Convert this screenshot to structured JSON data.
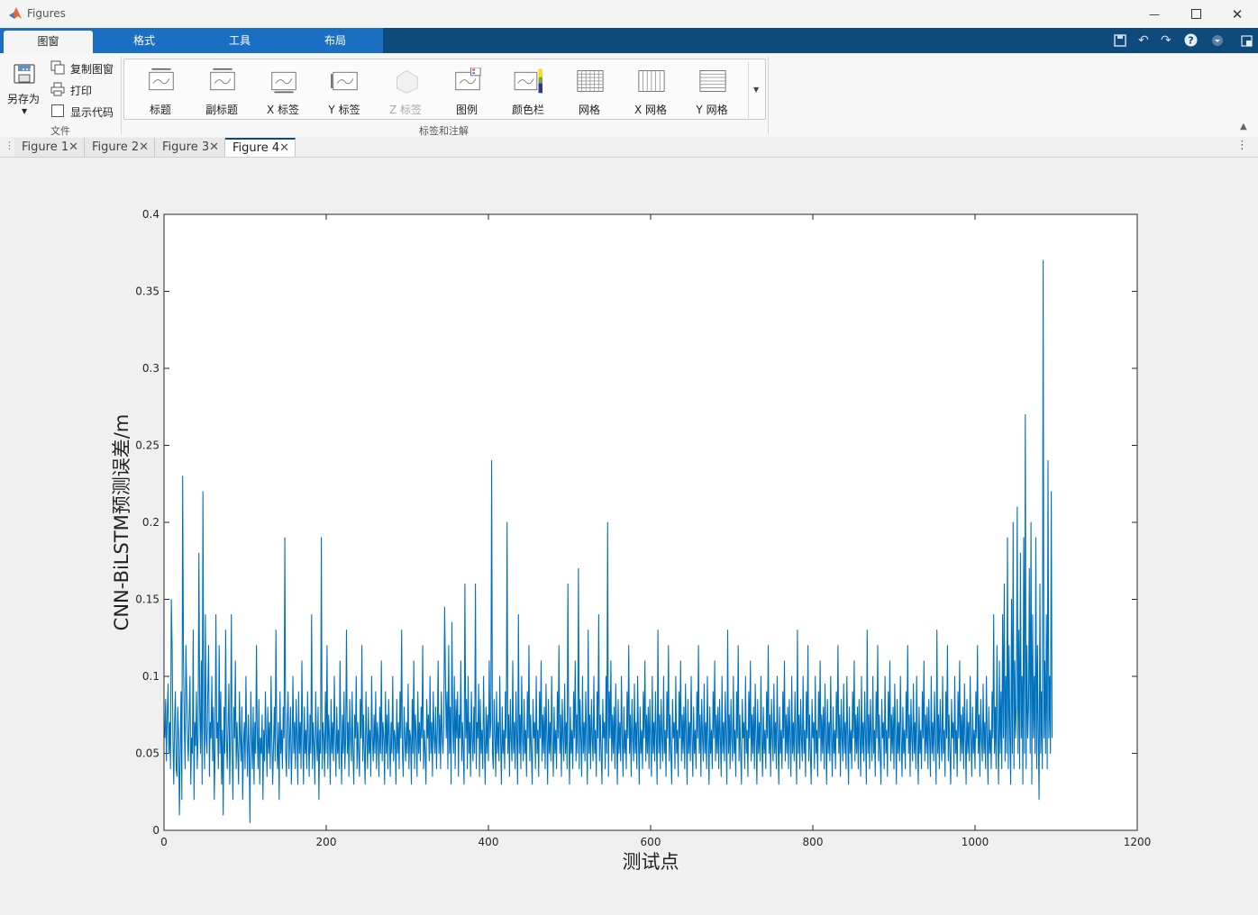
{
  "window": {
    "title": "Figures"
  },
  "ribbon_tabs": [
    "图窗",
    "格式",
    "工具",
    "布局"
  ],
  "file_group": {
    "save_as": "另存为",
    "copy_figure": "复制图窗",
    "print": "打印",
    "show_code": "显示代码",
    "label": "文件"
  },
  "annotation_group": {
    "label": "标签和注解",
    "buttons": [
      "标题",
      "副标题",
      "X 标签",
      "Y 标签",
      "Z 标签",
      "图例",
      "颜色栏",
      "网格",
      "X 网格",
      "Y 网格"
    ]
  },
  "figure_tabs": [
    "Figure 1",
    "Figure 2",
    "Figure 3",
    "Figure 4"
  ],
  "colors": {
    "line": "#0072BD",
    "tabbar": "#0e4a7c",
    "tab_blue": "#1a6fc2"
  },
  "chart_data": {
    "type": "line",
    "xlabel": "测试点",
    "ylabel": "CNN-BiLSTM预测误差/m",
    "xlim": [
      0,
      1200
    ],
    "ylim": [
      0,
      0.4
    ],
    "xticks": [
      "0",
      "200",
      "400",
      "600",
      "800",
      "1000",
      "1200"
    ],
    "yticks": [
      "0",
      "0.05",
      "0.1",
      "0.15",
      "0.2",
      "0.25",
      "0.3",
      "0.35",
      "0.4"
    ],
    "grid": false,
    "series": [
      {
        "x_start": 1,
        "x_step": 1,
        "y": [
          0.06,
          0.085,
          0.045,
          0.075,
          0.095,
          0.05,
          0.07,
          0.04,
          0.15,
          0.12,
          0.06,
          0.03,
          0.07,
          0.09,
          0.04,
          0.035,
          0.08,
          0.06,
          0.01,
          0.05,
          0.09,
          0.02,
          0.23,
          0.11,
          0.07,
          0.04,
          0.12,
          0.09,
          0.06,
          0.045,
          0.075,
          0.1,
          0.03,
          0.06,
          0.05,
          0.13,
          0.02,
          0.07,
          0.055,
          0.09,
          0.04,
          0.06,
          0.18,
          0.08,
          0.05,
          0.11,
          0.03,
          0.22,
          0.07,
          0.04,
          0.14,
          0.06,
          0.05,
          0.09,
          0.12,
          0.035,
          0.07,
          0.06,
          0.1,
          0.045,
          0.08,
          0.02,
          0.055,
          0.14,
          0.06,
          0.07,
          0.04,
          0.12,
          0.05,
          0.09,
          0.03,
          0.065,
          0.01,
          0.08,
          0.05,
          0.13,
          0.06,
          0.04,
          0.07,
          0.095,
          0.03,
          0.06,
          0.14,
          0.05,
          0.02,
          0.08,
          0.06,
          0.11,
          0.04,
          0.07,
          0.05,
          0.03,
          0.09,
          0.06,
          0.045,
          0.08,
          0.02,
          0.055,
          0.07,
          0.04,
          0.1,
          0.06,
          0.035,
          0.075,
          0.05,
          0.005,
          0.09,
          0.06,
          0.04,
          0.08,
          0.03,
          0.07,
          0.05,
          0.12,
          0.06,
          0.04,
          0.085,
          0.03,
          0.06,
          0.05,
          0.075,
          0.02,
          0.065,
          0.045,
          0.09,
          0.06,
          0.035,
          0.08,
          0.05,
          0.07,
          0.04,
          0.1,
          0.06,
          0.03,
          0.055,
          0.08,
          0.045,
          0.13,
          0.06,
          0.04,
          0.07,
          0.02,
          0.09,
          0.05,
          0.065,
          0.04,
          0.08,
          0.06,
          0.19,
          0.05,
          0.035,
          0.07,
          0.09,
          0.04,
          0.06,
          0.08,
          0.03,
          0.055,
          0.1,
          0.05,
          0.07,
          0.04,
          0.085,
          0.06,
          0.03,
          0.09,
          0.05,
          0.07,
          0.04,
          0.11,
          0.06,
          0.03,
          0.08,
          0.05,
          0.065,
          0.04,
          0.09,
          0.06,
          0.035,
          0.075,
          0.05,
          0.14,
          0.04,
          0.07,
          0.055,
          0.03,
          0.09,
          0.06,
          0.045,
          0.08,
          0.02,
          0.065,
          0.05,
          0.19,
          0.04,
          0.07,
          0.06,
          0.035,
          0.09,
          0.05,
          0.12,
          0.04,
          0.075,
          0.06,
          0.03,
          0.085,
          0.05,
          0.07,
          0.045,
          0.1,
          0.06,
          0.035,
          0.08,
          0.05,
          0.065,
          0.04,
          0.11,
          0.06,
          0.03,
          0.075,
          0.05,
          0.09,
          0.04,
          0.06,
          0.13,
          0.05,
          0.07,
          0.035,
          0.085,
          0.06,
          0.045,
          0.09,
          0.05,
          0.03,
          0.075,
          0.06,
          0.1,
          0.04,
          0.07,
          0.05,
          0.035,
          0.085,
          0.06,
          0.12,
          0.045,
          0.075,
          0.05,
          0.03,
          0.09,
          0.06,
          0.04,
          0.08,
          0.05,
          0.065,
          0.035,
          0.1,
          0.06,
          0.045,
          0.075,
          0.05,
          0.09,
          0.04,
          0.07,
          0.06,
          0.035,
          0.08,
          0.05,
          0.11,
          0.045,
          0.07,
          0.06,
          0.03,
          0.09,
          0.05,
          0.075,
          0.04,
          0.085,
          0.06,
          0.035,
          0.07,
          0.05,
          0.1,
          0.045,
          0.065,
          0.06,
          0.03,
          0.085,
          0.05,
          0.07,
          0.04,
          0.09,
          0.06,
          0.13,
          0.05,
          0.035,
          0.08,
          0.06,
          0.045,
          0.07,
          0.05,
          0.095,
          0.04,
          0.065,
          0.06,
          0.03,
          0.085,
          0.05,
          0.11,
          0.04,
          0.075,
          0.06,
          0.035,
          0.09,
          0.05,
          0.07,
          0.045,
          0.08,
          0.06,
          0.12,
          0.04,
          0.065,
          0.05,
          0.03,
          0.085,
          0.06,
          0.075,
          0.045,
          0.1,
          0.05,
          0.07,
          0.035,
          0.09,
          0.06,
          0.05,
          0.08,
          0.04,
          0.065,
          0.11,
          0.05,
          0.075,
          0.04,
          0.09,
          0.06
        ],
        "y_part2": [
          0.05,
          0.07,
          0.145,
          0.1,
          0.06,
          0.09,
          0.04,
          0.12,
          0.05,
          0.08,
          0.03,
          0.135,
          0.07,
          0.05,
          0.1,
          0.04,
          0.085,
          0.06,
          0.09,
          0.035,
          0.075,
          0.06,
          0.11,
          0.045,
          0.07,
          0.05,
          0.03,
          0.16,
          0.06,
          0.085,
          0.04,
          0.1,
          0.05,
          0.07,
          0.035,
          0.09,
          0.06,
          0.045,
          0.08,
          0.05,
          0.16,
          0.04,
          0.07,
          0.06,
          0.095,
          0.035,
          0.085,
          0.05,
          0.065,
          0.04,
          0.1,
          0.06,
          0.03,
          0.08,
          0.05,
          0.075,
          0.045,
          0.11,
          0.06,
          0.07,
          0.24,
          0.05,
          0.04,
          0.085,
          0.06,
          0.035,
          0.09,
          0.05,
          0.07,
          0.045,
          0.1,
          0.06,
          0.03,
          0.08,
          0.05,
          0.065,
          0.04,
          0.09,
          0.06,
          0.2,
          0.05,
          0.075,
          0.035,
          0.085,
          0.06,
          0.045,
          0.11,
          0.05,
          0.07,
          0.04,
          0.09,
          0.06,
          0.03,
          0.14,
          0.05,
          0.075,
          0.04,
          0.1,
          0.06,
          0.045,
          0.085,
          0.05,
          0.065,
          0.035,
          0.09,
          0.06,
          0.12,
          0.045,
          0.075,
          0.05,
          0.03,
          0.085,
          0.06,
          0.07,
          0.04,
          0.1,
          0.05,
          0.065,
          0.035,
          0.09,
          0.06,
          0.11,
          0.045,
          0.075,
          0.05,
          0.08,
          0.04,
          0.095,
          0.06,
          0.03,
          0.085,
          0.05,
          0.07,
          0.045,
          0.1,
          0.06,
          0.035,
          0.08,
          0.05,
          0.065,
          0.04,
          0.09,
          0.06,
          0.12,
          0.05,
          0.075,
          0.035,
          0.085,
          0.06,
          0.045,
          0.095,
          0.05,
          0.07,
          0.04,
          0.16,
          0.06,
          0.03,
          0.08,
          0.05,
          0.065,
          0.04,
          0.09,
          0.06,
          0.11,
          0.045,
          0.075,
          0.05,
          0.17,
          0.04,
          0.085,
          0.06,
          0.035,
          0.1,
          0.05,
          0.07,
          0.045,
          0.09,
          0.06,
          0.03,
          0.13,
          0.05,
          0.075,
          0.04,
          0.085,
          0.06,
          0.045,
          0.1,
          0.05,
          0.065,
          0.035,
          0.09,
          0.06,
          0.14,
          0.045,
          0.075,
          0.05,
          0.03,
          0.085,
          0.06,
          0.07,
          0.04,
          0.1,
          0.05,
          0.2,
          0.035,
          0.09,
          0.06,
          0.11,
          0.045,
          0.075,
          0.05,
          0.08,
          0.04,
          0.095,
          0.06,
          0.03,
          0.085,
          0.05,
          0.07,
          0.045,
          0.1,
          0.06,
          0.035,
          0.08,
          0.05,
          0.065,
          0.04,
          0.09,
          0.06,
          0.12,
          0.05,
          0.075,
          0.035,
          0.085,
          0.06,
          0.045,
          0.095,
          0.05,
          0.07,
          0.04,
          0.1,
          0.06,
          0.03,
          0.08,
          0.05,
          0.065,
          0.04,
          0.09,
          0.06,
          0.11,
          0.045,
          0.075,
          0.05,
          0.08,
          0.04,
          0.085,
          0.06,
          0.035,
          0.1,
          0.05,
          0.07,
          0.045,
          0.09,
          0.06,
          0.03,
          0.13,
          0.05,
          0.075,
          0.04,
          0.085,
          0.06,
          0.045,
          0.1,
          0.05,
          0.065,
          0.035,
          0.09,
          0.06,
          0.12,
          0.045,
          0.075,
          0.05,
          0.03,
          0.085,
          0.06,
          0.07,
          0.04,
          0.1,
          0.05,
          0.065,
          0.035,
          0.09,
          0.06,
          0.11,
          0.045,
          0.075,
          0.05,
          0.08,
          0.04,
          0.095,
          0.06,
          0.03,
          0.085,
          0.05,
          0.07,
          0.045,
          0.1,
          0.06,
          0.035,
          0.08,
          0.05,
          0.065,
          0.04,
          0.09,
          0.06,
          0.12,
          0.05,
          0.075,
          0.035,
          0.085,
          0.06,
          0.045,
          0.095,
          0.05,
          0.07,
          0.04,
          0.1,
          0.06,
          0.03,
          0.08,
          0.05,
          0.065,
          0.04,
          0.09,
          0.06,
          0.11,
          0.045,
          0.075,
          0.05,
          0.08,
          0.04,
          0.085,
          0.06,
          0.035,
          0.1,
          0.05,
          0.07,
          0.045,
          0.09,
          0.06,
          0.03,
          0.13,
          0.05,
          0.075,
          0.04,
          0.085,
          0.06,
          0.045,
          0.1,
          0.05,
          0.065,
          0.035,
          0.09,
          0.06,
          0.12,
          0.045,
          0.075,
          0.05,
          0.03,
          0.085,
          0.06,
          0.07,
          0.04,
          0.1,
          0.05,
          0.065,
          0.035,
          0.09,
          0.06,
          0.11,
          0.045,
          0.075,
          0.05,
          0.08,
          0.04,
          0.095,
          0.06,
          0.03,
          0.085,
          0.05,
          0.07,
          0.045,
          0.1,
          0.06,
          0.035,
          0.08,
          0.05,
          0.065,
          0.04,
          0.09,
          0.06,
          0.12,
          0.05,
          0.075,
          0.035,
          0.085,
          0.06,
          0.045,
          0.095,
          0.05,
          0.07,
          0.04,
          0.1,
          0.06,
          0.03,
          0.08,
          0.05,
          0.065,
          0.04,
          0.09,
          0.06,
          0.11,
          0.045,
          0.075,
          0.05,
          0.08,
          0.04,
          0.085,
          0.06,
          0.035,
          0.1,
          0.05,
          0.07,
          0.045,
          0.09,
          0.06,
          0.03,
          0.13,
          0.05,
          0.075,
          0.04,
          0.085,
          0.06,
          0.045,
          0.1,
          0.05,
          0.065,
          0.035,
          0.09,
          0.06,
          0.12,
          0.045,
          0.075,
          0.05,
          0.03,
          0.085,
          0.06,
          0.07,
          0.04,
          0.1,
          0.05,
          0.065,
          0.035,
          0.09,
          0.06,
          0.11,
          0.045,
          0.075,
          0.05,
          0.08,
          0.04,
          0.095,
          0.06,
          0.03,
          0.085,
          0.05,
          0.07,
          0.045,
          0.1,
          0.06,
          0.035,
          0.08,
          0.05,
          0.065,
          0.04,
          0.09,
          0.06,
          0.12,
          0.05,
          0.075,
          0.035,
          0.085,
          0.06,
          0.045,
          0.095,
          0.05,
          0.07,
          0.04,
          0.1,
          0.06,
          0.03,
          0.08,
          0.05,
          0.065,
          0.04,
          0.09,
          0.06,
          0.11,
          0.045,
          0.075,
          0.05,
          0.08,
          0.04,
          0.085,
          0.06,
          0.035,
          0.1,
          0.05,
          0.07,
          0.045,
          0.09,
          0.06,
          0.03,
          0.13,
          0.05,
          0.075,
          0.04,
          0.085,
          0.06,
          0.045,
          0.1,
          0.05,
          0.065,
          0.035,
          0.09,
          0.06,
          0.12,
          0.045,
          0.075,
          0.05,
          0.03,
          0.085,
          0.06,
          0.07,
          0.04,
          0.1,
          0.05,
          0.065,
          0.035,
          0.09,
          0.06,
          0.11,
          0.045,
          0.075,
          0.05,
          0.08,
          0.04,
          0.095,
          0.06,
          0.03,
          0.085,
          0.05,
          0.07,
          0.045,
          0.1,
          0.06,
          0.035,
          0.08,
          0.05,
          0.065,
          0.04,
          0.09,
          0.06,
          0.12,
          0.05,
          0.075,
          0.035,
          0.085,
          0.06,
          0.045,
          0.095,
          0.05,
          0.07,
          0.04,
          0.1,
          0.06,
          0.03,
          0.08,
          0.05,
          0.065,
          0.04,
          0.09,
          0.06,
          0.11,
          0.045,
          0.075,
          0.05,
          0.08,
          0.04,
          0.085,
          0.06,
          0.035,
          0.1,
          0.05,
          0.07,
          0.045,
          0.09,
          0.06,
          0.03,
          0.13,
          0.05,
          0.075,
          0.04,
          0.085,
          0.06,
          0.045,
          0.1,
          0.05,
          0.065,
          0.035,
          0.09,
          0.06,
          0.12,
          0.045,
          0.075,
          0.05,
          0.03,
          0.085,
          0.06,
          0.07,
          0.04,
          0.1,
          0.05,
          0.065,
          0.035,
          0.09,
          0.06,
          0.11,
          0.045,
          0.075,
          0.05,
          0.08,
          0.04,
          0.095,
          0.06,
          0.03,
          0.085,
          0.05,
          0.07,
          0.045,
          0.1,
          0.06,
          0.035,
          0.08,
          0.05,
          0.065,
          0.04,
          0.09,
          0.06,
          0.12,
          0.05,
          0.075,
          0.035,
          0.085,
          0.06,
          0.045,
          0.095,
          0.05,
          0.07,
          0.04,
          0.1,
          0.06,
          0.03,
          0.08,
          0.05,
          0.065,
          0.04,
          0.09,
          0.06,
          0.14,
          0.05,
          0.08,
          0.04,
          0.12,
          0.06,
          0.03,
          0.11,
          0.05,
          0.09,
          0.04,
          0.14,
          0.06,
          0.16,
          0.045,
          0.1,
          0.05,
          0.19,
          0.04,
          0.12,
          0.06,
          0.03,
          0.15,
          0.05,
          0.2,
          0.04,
          0.11,
          0.06,
          0.08,
          0.21,
          0.05,
          0.13,
          0.04,
          0.18,
          0.06,
          0.1,
          0.03,
          0.19,
          0.05,
          0.27,
          0.04,
          0.12,
          0.06,
          0.08,
          0.17,
          0.05,
          0.2,
          0.03,
          0.14,
          0.06,
          0.1,
          0.05,
          0.19,
          0.04,
          0.12,
          0.06,
          0.02,
          0.16,
          0.05,
          0.09,
          0.04,
          0.37,
          0.06,
          0.11,
          0.05,
          0.14,
          0.04,
          0.24,
          0.06,
          0.1,
          0.05,
          0.22,
          0.06
        ]
      }
    ]
  }
}
